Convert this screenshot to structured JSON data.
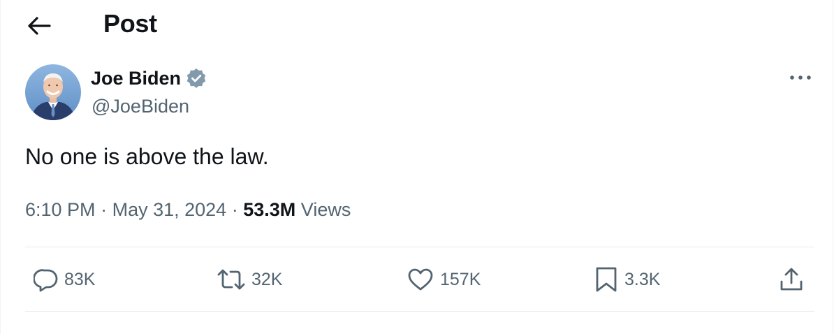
{
  "header": {
    "title": "Post",
    "back_icon": "arrow-left-icon"
  },
  "author": {
    "display_name": "Joe Biden",
    "handle": "@JoeBiden",
    "verified_icon": "verified-badge-icon",
    "verified_color": "#829aab"
  },
  "post": {
    "text": "No one is above the law.",
    "time": "6:10 PM",
    "date": "May 31, 2024",
    "views_count": "53.3M",
    "views_label": "Views",
    "separator": "·"
  },
  "actions": {
    "reply_count": "83K",
    "repost_count": "32K",
    "like_count": "157K",
    "bookmark_count": "3.3K",
    "reply_icon": "speech-bubble-icon",
    "repost_icon": "repost-arrows-icon",
    "like_icon": "heart-icon",
    "bookmark_icon": "bookmark-icon",
    "share_icon": "share-upload-icon"
  },
  "colors": {
    "text_primary": "#0f1419",
    "text_secondary": "#536471",
    "divider": "#e7ebee"
  }
}
